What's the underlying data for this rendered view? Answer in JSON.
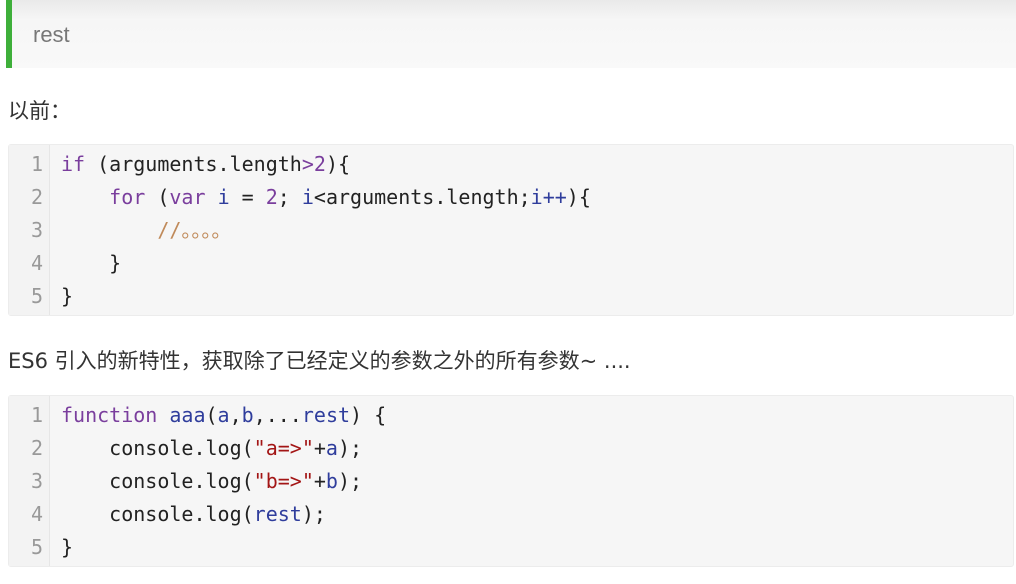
{
  "callout": {
    "text": "rest"
  },
  "paragraphs": {
    "before": "以前：",
    "es6": "ES6 引入的新特性，获取除了已经定义的参数之外的所有参数~  ...."
  },
  "code_blocks": [
    {
      "lines": [
        {
          "number": "1",
          "tokens": [
            {
              "t": "if",
              "c": "kw"
            },
            {
              "t": " (arguments.length",
              "c": ""
            },
            {
              "t": ">",
              "c": "kw"
            },
            {
              "t": "2",
              "c": "num"
            },
            {
              "t": "){",
              "c": ""
            }
          ]
        },
        {
          "number": "2",
          "tokens": [
            {
              "t": "    ",
              "c": ""
            },
            {
              "t": "for",
              "c": "kw"
            },
            {
              "t": " (",
              "c": ""
            },
            {
              "t": "var",
              "c": "kw"
            },
            {
              "t": " ",
              "c": ""
            },
            {
              "t": "i",
              "c": "vn"
            },
            {
              "t": " = ",
              "c": ""
            },
            {
              "t": "2",
              "c": "num"
            },
            {
              "t": "; ",
              "c": ""
            },
            {
              "t": "i",
              "c": "vn"
            },
            {
              "t": "<arguments.length;",
              "c": ""
            },
            {
              "t": "i++",
              "c": "vn"
            },
            {
              "t": "){",
              "c": ""
            }
          ]
        },
        {
          "number": "3",
          "tokens": [
            {
              "t": "        ",
              "c": ""
            },
            {
              "t": "//。。。。",
              "c": "cm"
            }
          ]
        },
        {
          "number": "4",
          "tokens": [
            {
              "t": "    }",
              "c": ""
            }
          ]
        },
        {
          "number": "5",
          "tokens": [
            {
              "t": "}",
              "c": ""
            }
          ]
        }
      ]
    },
    {
      "lines": [
        {
          "number": "1",
          "tokens": [
            {
              "t": "function",
              "c": "kw"
            },
            {
              "t": " ",
              "c": ""
            },
            {
              "t": "aaa",
              "c": "vn"
            },
            {
              "t": "(",
              "c": ""
            },
            {
              "t": "a",
              "c": "vn"
            },
            {
              "t": ",",
              "c": ""
            },
            {
              "t": "b",
              "c": "vn"
            },
            {
              "t": ",...",
              "c": ""
            },
            {
              "t": "rest",
              "c": "vn"
            },
            {
              "t": ") {",
              "c": ""
            }
          ]
        },
        {
          "number": "2",
          "tokens": [
            {
              "t": "    console.log(",
              "c": ""
            },
            {
              "t": "\"a=>\"",
              "c": "str"
            },
            {
              "t": "+",
              "c": ""
            },
            {
              "t": "a",
              "c": "vn"
            },
            {
              "t": ");",
              "c": ""
            }
          ]
        },
        {
          "number": "3",
          "tokens": [
            {
              "t": "    console.log(",
              "c": ""
            },
            {
              "t": "\"b=>\"",
              "c": "str"
            },
            {
              "t": "+",
              "c": ""
            },
            {
              "t": "b",
              "c": "vn"
            },
            {
              "t": ");",
              "c": ""
            }
          ]
        },
        {
          "number": "4",
          "tokens": [
            {
              "t": "    console.log(",
              "c": ""
            },
            {
              "t": "rest",
              "c": "vn"
            },
            {
              "t": ");",
              "c": ""
            }
          ]
        },
        {
          "number": "5",
          "tokens": [
            {
              "t": "}",
              "c": ""
            }
          ]
        }
      ]
    }
  ],
  "colors": {
    "callout_border": "#3eaf3a",
    "keyword": "#7a3e9d",
    "string": "#a31515",
    "comment": "#c08a5a",
    "variable": "#2f3d9c"
  }
}
